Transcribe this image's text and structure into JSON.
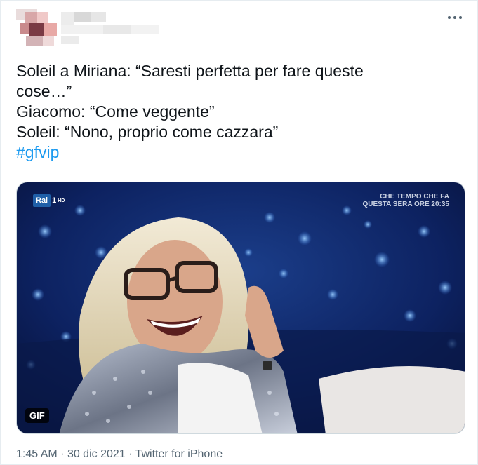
{
  "tweet": {
    "text_lines": [
      "Soleil a Miriana: “Saresti perfetta per fare queste",
      "cose…”",
      "Giacomo: “Come veggente”",
      "Soleil: “Nono, proprio come cazzara”"
    ],
    "hashtag": "#gfvip"
  },
  "media": {
    "type": "gif",
    "badge": "GIF",
    "channel_logo": "Rai",
    "channel_number": "1",
    "channel_hd": "HD",
    "overlay_line1": "CHE TEMPO CHE FA",
    "overlay_line2": "QUESTA SERA ORE 20:35"
  },
  "meta": {
    "time": "1:45 AM",
    "separator": "·",
    "date": "30 dic 2021",
    "source": "Twitter for iPhone"
  },
  "icons": {
    "more": "more-horizontal-icon"
  },
  "colors": {
    "text": "#0f1419",
    "secondary": "#536471",
    "link": "#1d9bf0",
    "border": "#cfd9de"
  }
}
